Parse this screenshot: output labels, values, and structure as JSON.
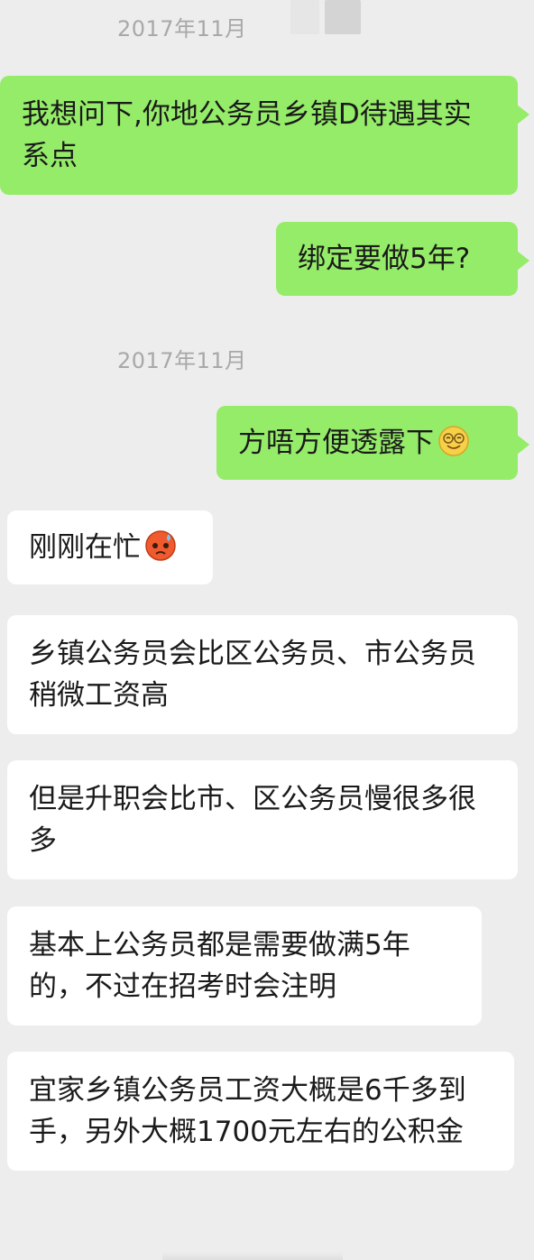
{
  "chat": {
    "timestamps": [
      "2017年11月",
      "2017年11月"
    ],
    "messages": [
      {
        "side": "out",
        "text": "我想问下,你地公务员乡镇D待遇其实系点"
      },
      {
        "side": "out",
        "text": "绑定要做5年?"
      },
      {
        "side": "out",
        "text": "方唔方便透露下",
        "emoji": "smiling-glasses-emoji"
      },
      {
        "side": "in",
        "text": "刚刚在忙",
        "emoji": "angry-sweat-emoji"
      },
      {
        "side": "in",
        "text": "乡镇公务员会比区公务员、市公务员稍微工资高"
      },
      {
        "side": "in",
        "text": "但是升职会比市、区公务员慢很多很多"
      },
      {
        "side": "in",
        "text": "基本上公务员都是需要做满5年的，不过在招考时会注明"
      },
      {
        "side": "in",
        "text": "宜家乡镇公务员工资大概是6千多到手，另外大概1700元左右的公积金"
      }
    ]
  },
  "colors": {
    "background": "#ededed",
    "outgoing_bubble": "#95ec69",
    "incoming_bubble": "#ffffff",
    "timestamp_text": "#a8a8a8"
  }
}
